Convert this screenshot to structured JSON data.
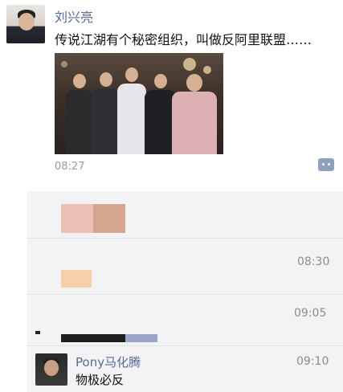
{
  "post": {
    "author": "刘兴亮",
    "text": "传说江湖有个秘密组织，叫做反阿里联盟……",
    "time": "08:27",
    "avatar_icon": "user-avatar-photo",
    "comment_icon": "more-dots-icon"
  },
  "feed": {
    "comment_times": [
      "08:30",
      "09:05"
    ],
    "pony": {
      "name": "Pony马化腾",
      "text": "物极必反",
      "time": "09:10"
    }
  },
  "colors": {
    "link_blue": "#576b95",
    "feed_bg": "#f3f3f5",
    "time_gray": "#8c8c8c"
  }
}
